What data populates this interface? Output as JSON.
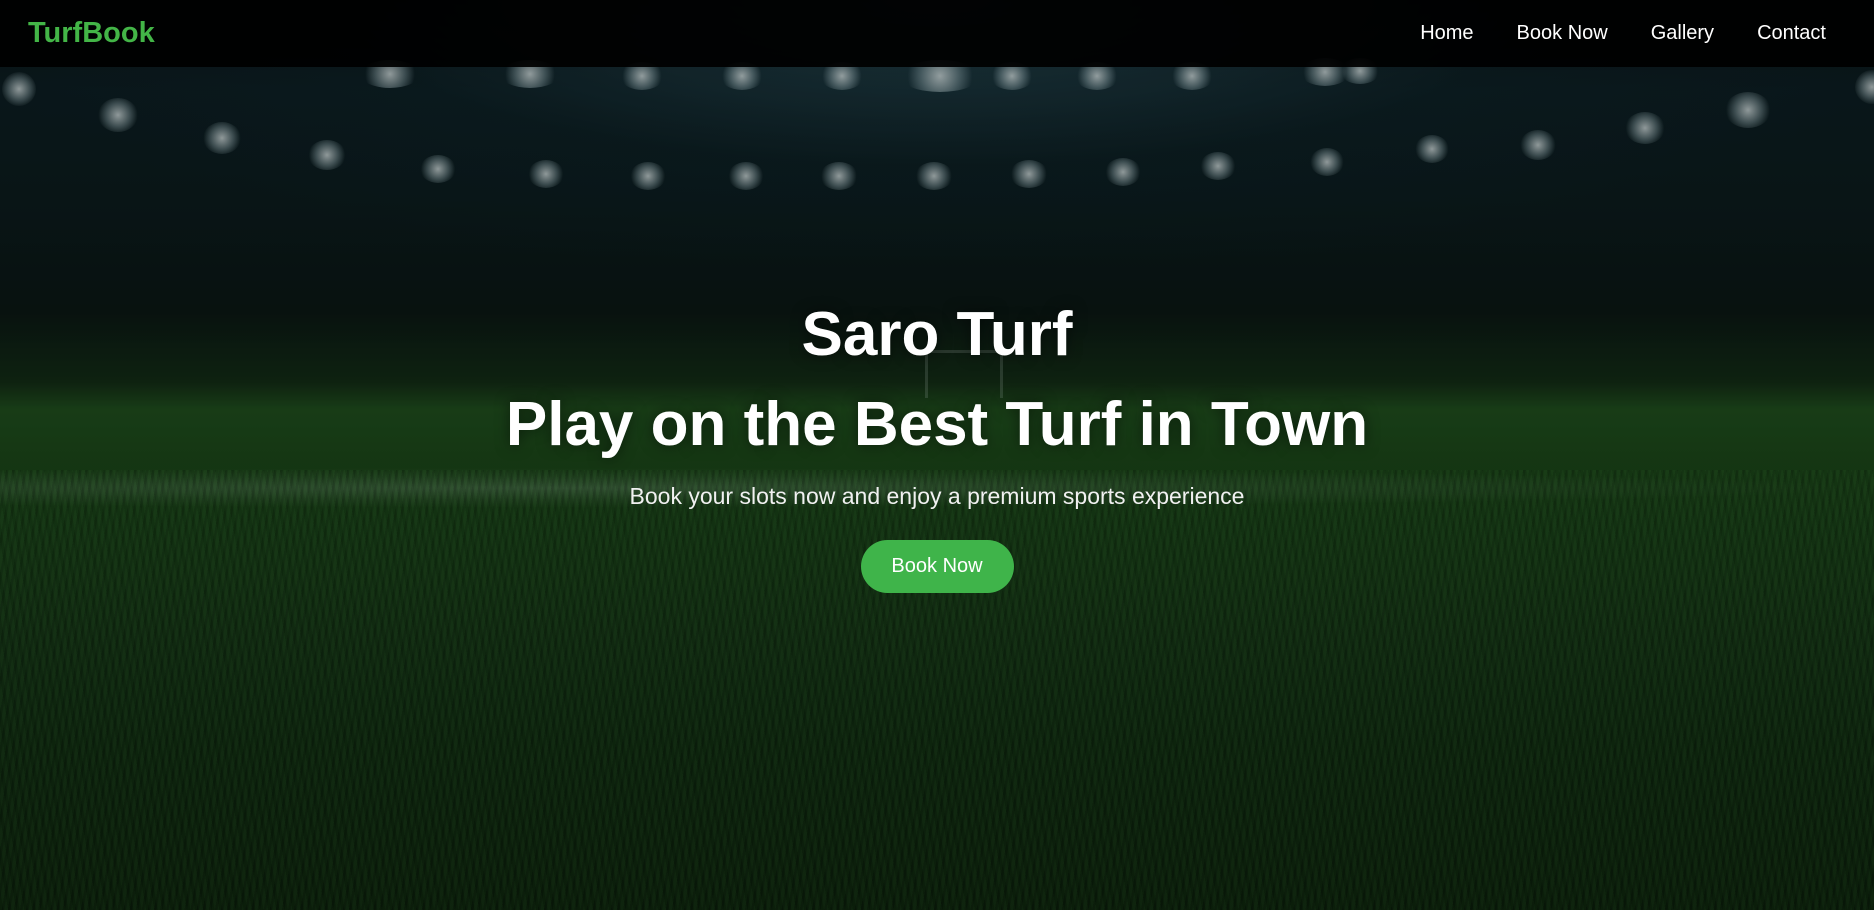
{
  "navbar": {
    "brand": "TurfBook",
    "links": [
      {
        "label": "Home"
      },
      {
        "label": "Book Now"
      },
      {
        "label": "Gallery"
      },
      {
        "label": "Contact"
      }
    ]
  },
  "hero": {
    "title": "Saro Turf",
    "subtitle": "Play on the Best Turf in Town",
    "tagline": "Book your slots now and enjoy a premium sports experience",
    "cta_label": "Book Now",
    "background": "night-stadium-turf-image"
  },
  "colors": {
    "brand_green": "#43b547",
    "button_green": "#3fb44a",
    "navbar_bg": "#000000",
    "text": "#ffffff"
  }
}
